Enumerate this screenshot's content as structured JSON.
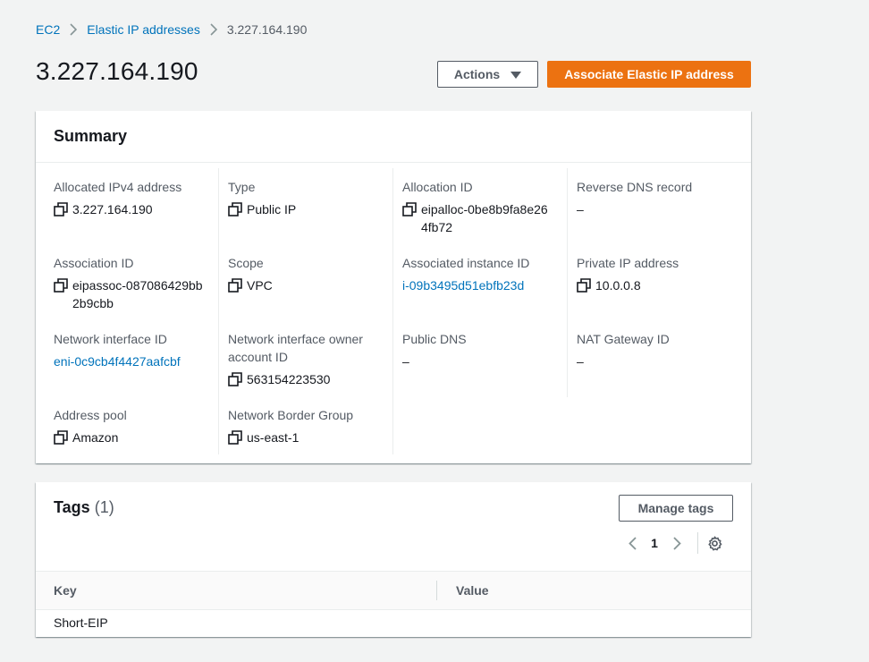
{
  "breadcrumb": {
    "items": [
      "EC2",
      "Elastic IP addresses"
    ],
    "current": "3.227.164.190"
  },
  "page": {
    "title": "3.227.164.190"
  },
  "header_actions": {
    "actions_label": "Actions",
    "associate_label": "Associate Elastic IP address"
  },
  "summary": {
    "title": "Summary",
    "fields": {
      "allocated_ipv4": {
        "label": "Allocated IPv4 address",
        "value": "3.227.164.190"
      },
      "type": {
        "label": "Type",
        "value": "Public IP"
      },
      "allocation_id": {
        "label": "Allocation ID",
        "value": "eipalloc-0be8b9fa8e264fb72"
      },
      "reverse_dns": {
        "label": "Reverse DNS record",
        "value": "–"
      },
      "association_id": {
        "label": "Association ID",
        "value": "eipassoc-087086429bb2b9cbb"
      },
      "scope": {
        "label": "Scope",
        "value": "VPC"
      },
      "associated_instance": {
        "label": "Associated instance ID",
        "value": "i-09b3495d51ebfb23d"
      },
      "private_ip": {
        "label": "Private IP address",
        "value": "10.0.0.8"
      },
      "network_interface_id": {
        "label": "Network interface ID",
        "value": "eni-0c9cb4f4427aafcbf"
      },
      "ni_owner": {
        "label": "Network interface owner account ID",
        "value": "563154223530"
      },
      "public_dns": {
        "label": "Public DNS",
        "value": "–"
      },
      "nat_gateway": {
        "label": "NAT Gateway ID",
        "value": "–"
      },
      "address_pool": {
        "label": "Address pool",
        "value": "Amazon"
      },
      "border_group": {
        "label": "Network Border Group",
        "value": "us-east-1"
      }
    }
  },
  "tags": {
    "title": "Tags",
    "count": "(1)",
    "manage_label": "Manage tags",
    "page_number": "1",
    "columns": [
      "Key",
      "Value"
    ],
    "rows": [
      {
        "key": "Short-EIP",
        "value": ""
      }
    ]
  },
  "colors": {
    "link": "#0073bb",
    "primary": "#ec7211",
    "background": "#f2f3f3"
  }
}
